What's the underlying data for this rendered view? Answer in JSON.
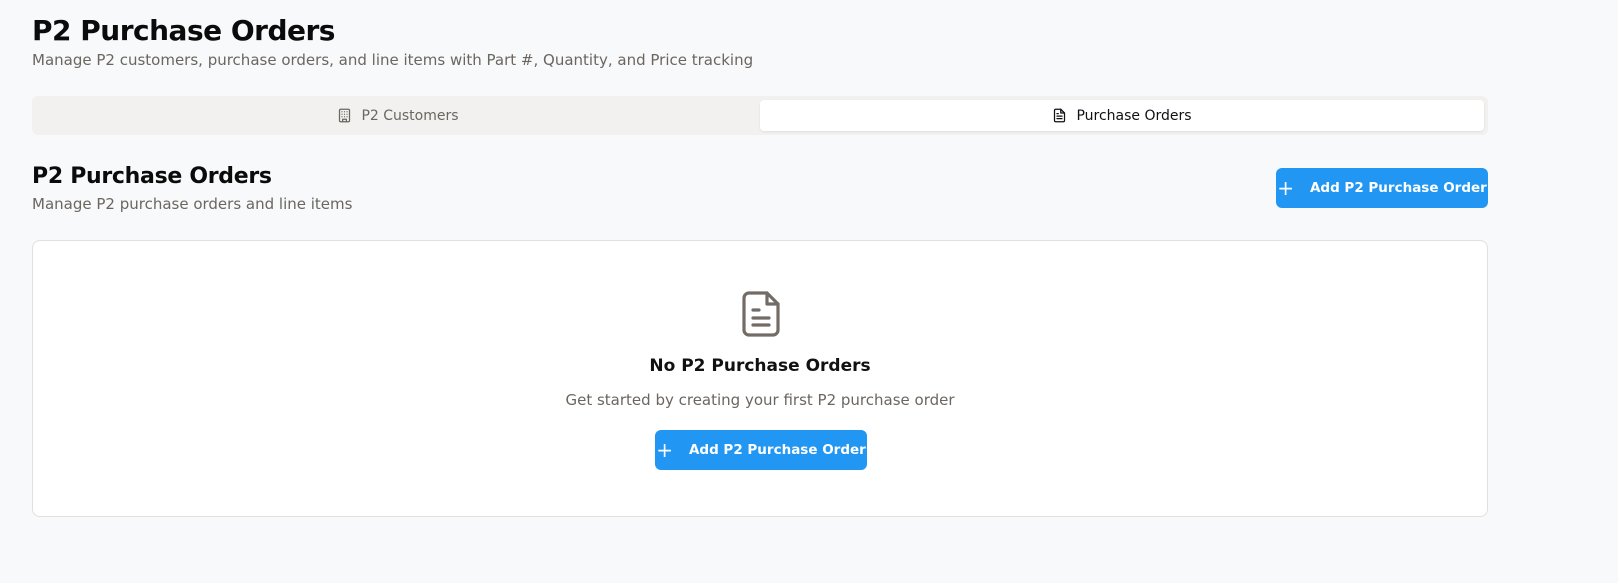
{
  "header": {
    "title": "P2 Purchase Orders",
    "subtitle": "Manage P2 customers, purchase orders, and line items with Part #, Quantity, and Price tracking"
  },
  "tabs": [
    {
      "label": "P2 Customers",
      "icon": "building-icon",
      "active": false
    },
    {
      "label": "Purchase Orders",
      "icon": "file-text-icon",
      "active": true
    }
  ],
  "section": {
    "title": "P2 Purchase Orders",
    "subtitle": "Manage P2 purchase orders and line items",
    "add_button_label": "Add P2 Purchase Order"
  },
  "empty_state": {
    "icon": "file-text-icon",
    "title": "No P2 Purchase Orders",
    "description": "Get started by creating your first P2 purchase order",
    "button_label": "Add P2 Purchase Order"
  },
  "colors": {
    "accent": "#2196f3",
    "background": "#f8f9fa",
    "muted_text": "#6b6660"
  }
}
